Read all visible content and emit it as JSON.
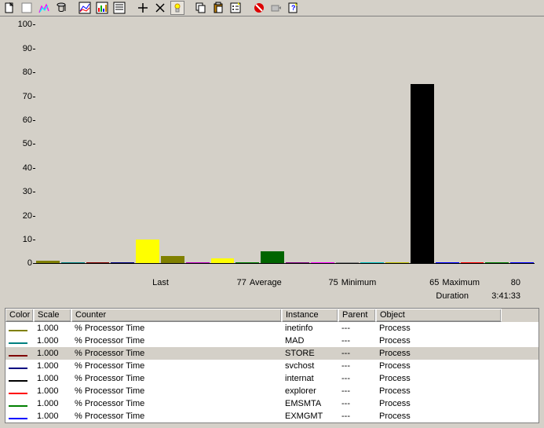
{
  "toolbar": {
    "buttons": [
      "new-counter-set",
      "clear-display",
      "view-current",
      "view-log",
      "view-chart",
      "view-histogram",
      "view-report",
      "add",
      "delete",
      "highlight",
      "copy",
      "paste",
      "properties",
      "freeze",
      "update",
      "help"
    ]
  },
  "stats": {
    "last_label": "Last",
    "last": "77",
    "avg_label": "Average",
    "avg": "75",
    "min_label": "Minimum",
    "min": "65",
    "max_label": "Maximum",
    "max": "80",
    "dur_label": "Duration",
    "dur": "3:41:33"
  },
  "chart_data": {
    "type": "bar",
    "ylim": [
      0,
      100
    ],
    "yticks": [
      0,
      10,
      20,
      30,
      40,
      50,
      60,
      70,
      80,
      90,
      100
    ],
    "bars": [
      {
        "value": 1,
        "color": "#808000"
      },
      {
        "value": 0.5,
        "color": "#008080"
      },
      {
        "value": 0.5,
        "color": "#800000"
      },
      {
        "value": 0.5,
        "color": "#000080"
      },
      {
        "value": 10,
        "color": "#ffff00"
      },
      {
        "value": 3,
        "color": "#808000"
      },
      {
        "value": 0.5,
        "color": "#c000c0"
      },
      {
        "value": 2,
        "color": "#ffff00"
      },
      {
        "value": 0.5,
        "color": "#008000"
      },
      {
        "value": 5,
        "color": "#006400"
      },
      {
        "value": 0.5,
        "color": "#800080"
      },
      {
        "value": 0.5,
        "color": "#ff00ff"
      },
      {
        "value": 0.5,
        "color": "#808080"
      },
      {
        "value": 0.5,
        "color": "#00c0c0"
      },
      {
        "value": 0.5,
        "color": "#c0c000"
      },
      {
        "value": 75,
        "color": "#000000"
      },
      {
        "value": 0.5,
        "color": "#0000ff"
      },
      {
        "value": 0.5,
        "color": "#ff0000"
      },
      {
        "value": 0.5,
        "color": "#008000"
      },
      {
        "value": 0.5,
        "color": "#0000ff"
      }
    ]
  },
  "table": {
    "headers": {
      "color": "Color",
      "scale": "Scale",
      "counter": "Counter",
      "instance": "Instance",
      "parent": "Parent",
      "object": "Object"
    },
    "rows": [
      {
        "color": "#808000",
        "scale": "1.000",
        "counter": "% Processor Time",
        "instance": "inetinfo",
        "parent": "---",
        "object": "Process",
        "sel": false
      },
      {
        "color": "#008080",
        "scale": "1.000",
        "counter": "% Processor Time",
        "instance": "MAD",
        "parent": "---",
        "object": "Process",
        "sel": false
      },
      {
        "color": "#800000",
        "scale": "1.000",
        "counter": "% Processor Time",
        "instance": "STORE",
        "parent": "---",
        "object": "Process",
        "sel": true
      },
      {
        "color": "#000080",
        "scale": "1.000",
        "counter": "% Processor Time",
        "instance": "svchost",
        "parent": "---",
        "object": "Process",
        "sel": false
      },
      {
        "color": "#000000",
        "scale": "1.000",
        "counter": "% Processor Time",
        "instance": "internat",
        "parent": "---",
        "object": "Process",
        "sel": false
      },
      {
        "color": "#ff0000",
        "scale": "1.000",
        "counter": "% Processor Time",
        "instance": "explorer",
        "parent": "---",
        "object": "Process",
        "sel": false
      },
      {
        "color": "#008000",
        "scale": "1.000",
        "counter": "% Processor Time",
        "instance": "EMSMTA",
        "parent": "---",
        "object": "Process",
        "sel": false
      },
      {
        "color": "#0000ff",
        "scale": "1.000",
        "counter": "% Processor Time",
        "instance": "EXMGMT",
        "parent": "---",
        "object": "Process",
        "sel": false
      }
    ]
  }
}
